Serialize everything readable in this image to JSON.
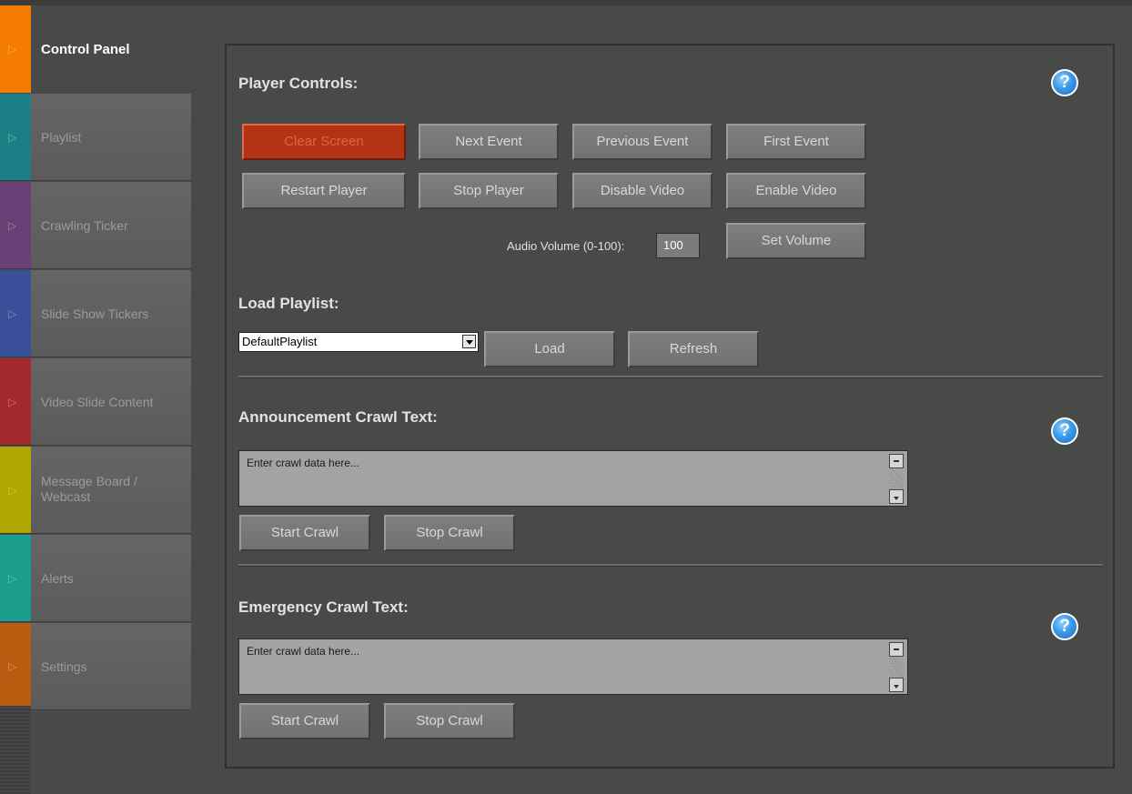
{
  "sidebar": {
    "items": [
      {
        "label": "Control Panel",
        "color": "#f47c00",
        "active": true
      },
      {
        "label": "Playlist",
        "color": "#1d7f86"
      },
      {
        "label": "Crawling Ticker",
        "color": "#6a3f76"
      },
      {
        "label": "Slide Show Tickers",
        "color": "#3a4f9a"
      },
      {
        "label": "Video Slide Content",
        "color": "#a52a2e"
      },
      {
        "label": "Message Board / Webcast",
        "color": "#b0a800"
      },
      {
        "label": "Alerts",
        "color": "#1b9c8c"
      },
      {
        "label": "Settings",
        "color": "#b85c10"
      }
    ]
  },
  "player_controls": {
    "title": "Player Controls:",
    "buttons": {
      "clear_screen": "Clear Screen",
      "next_event": "Next Event",
      "previous_event": "Previous Event",
      "first_event": "First Event",
      "restart_player": "Restart Player",
      "stop_player": "Stop Player",
      "disable_video": "Disable Video",
      "enable_video": "Enable Video",
      "set_volume": "Set Volume"
    },
    "volume_label": "Audio Volume (0-100):",
    "volume_value": "100"
  },
  "load_playlist": {
    "title": "Load Playlist:",
    "selected": "DefaultPlaylist",
    "load": "Load",
    "refresh": "Refresh"
  },
  "announcement": {
    "title": "Announcement Crawl Text:",
    "placeholder": "Enter crawl data here...",
    "start": "Start Crawl",
    "stop": "Stop Crawl"
  },
  "emergency": {
    "title": "Emergency Crawl Text:",
    "placeholder": "Enter crawl data here...",
    "start": "Start Crawl",
    "stop": "Stop Crawl"
  },
  "help_glyph": "?",
  "nav_arrow_glyph": "▷"
}
